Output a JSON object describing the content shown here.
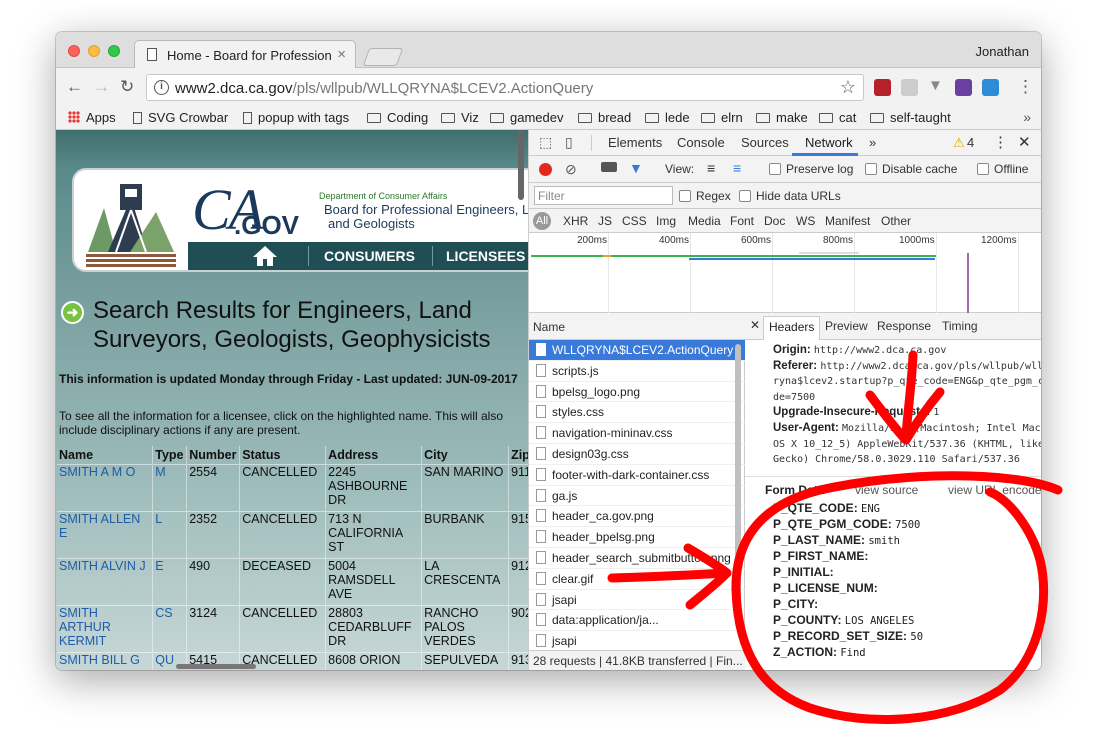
{
  "browser": {
    "tab_title": "Home - Board for Professional",
    "user": "Jonathan",
    "url_host": "www2.dca.ca.gov",
    "url_path": "/pls/wllpub/WLLQRYNA$LCEV2.ActionQuery",
    "bookmarks": [
      "Apps",
      "SVG Crowbar",
      "popup with tags",
      "Coding",
      "Viz",
      "gamedev",
      "bread",
      "lede",
      "elrn",
      "make",
      "cat",
      "self-taught"
    ],
    "bookmarks_more": "»"
  },
  "webpage": {
    "dept": "Department of Consumer Affairs",
    "board_line1": "Board for Professional Engineers, L",
    "board_line2": "and Geologists",
    "logo_ca": "CA",
    "logo_gov": ".GOV",
    "nav": {
      "consumers": "CONSUMERS",
      "licensees": "LICENSEES"
    },
    "heading": "Search Results for Engineers, Land Surveyors, Geologists, Geophysicists",
    "updated": "This information is updated Monday through Friday - Last updated: JUN-09-2017",
    "instructions": "To see all the information for a licensee, click on the highlighted name. This will also include disciplinary actions if any are present.",
    "columns": [
      "Name",
      "Type",
      "Number",
      "Status",
      "Address",
      "City",
      "Zip"
    ],
    "rows": [
      {
        "name": "SMITH A M O",
        "type": "M",
        "number": "2554",
        "status": "CANCELLED",
        "address": "2245 ASHBOURNE DR",
        "city": "SAN MARINO",
        "zip": "911"
      },
      {
        "name": "SMITH ALLEN E",
        "type": "L",
        "number": "2352",
        "status": "CANCELLED",
        "address": "713 N CALIFORNIA ST",
        "city": "BURBANK",
        "zip": "915"
      },
      {
        "name": "SMITH ALVIN J",
        "type": "E",
        "number": "490",
        "status": "DECEASED",
        "address": "5004 RAMSDELL AVE",
        "city": "LA CRESCENTA",
        "zip": "912"
      },
      {
        "name": "SMITH ARTHUR KERMIT",
        "type": "CS",
        "number": "3124",
        "status": "CANCELLED",
        "address": "28803 CEDARBLUFF DR",
        "city": "RANCHO PALOS VERDES",
        "zip": "902"
      },
      {
        "name": "SMITH BILL G",
        "type": "QU",
        "number": "5415",
        "status": "CANCELLED",
        "address": "8608 ORION",
        "city": "SEPULVEDA",
        "zip": "913"
      }
    ]
  },
  "devtools": {
    "tabs": [
      "Elements",
      "Console",
      "Sources",
      "Network",
      "»"
    ],
    "warnings": "4",
    "controls": {
      "view": "View:",
      "preserve_log": "Preserve log",
      "disable_cache": "Disable cache",
      "offline": "Offline"
    },
    "filter_placeholder": "Filter",
    "regex": "Regex",
    "hide_data_urls": "Hide data URLs",
    "types": [
      "All",
      "XHR",
      "JS",
      "CSS",
      "Img",
      "Media",
      "Font",
      "Doc",
      "WS",
      "Manifest",
      "Other"
    ],
    "ticks": [
      "200ms",
      "400ms",
      "600ms",
      "800ms",
      "1000ms",
      "1200ms"
    ],
    "name_header": "Name",
    "requests": [
      "WLLQRYNA$LCEV2.ActionQuery",
      "scripts.js",
      "bpelsg_logo.png",
      "styles.css",
      "navigation-mininav.css",
      "design03g.css",
      "footer-with-dark-container.css",
      "ga.js",
      "header_ca.gov.png",
      "header_bpelsg.png",
      "header_search_submitbutton.png",
      "clear.gif",
      "jsapi",
      "data:application/ja...",
      "jsapi"
    ],
    "summary": "28 requests | 41.8KB transferred | Fin...",
    "detail_tabs": [
      "Headers",
      "Preview",
      "Response",
      "Timing"
    ],
    "headers": [
      {
        "k": "Origin:",
        "v": "http://www2.dca.ca.gov"
      },
      {
        "k": "Referer:",
        "v": "http://www2.dca.ca.gov/pls/wllpub/wllqryna$lcev2.startup?p_qte_code=ENG&p_qte_pgm_code=7500"
      },
      {
        "k": "Upgrade-Insecure-Requests:",
        "v": "1"
      },
      {
        "k": "User-Agent:",
        "v": "Mozilla/5.0 (Macintosh; Intel Mac OS X 10_12_5) AppleWebKit/537.36 (KHTML, like Gecko) Chrome/58.0.3029.110 Safari/537.36"
      }
    ],
    "form_data_title": "Form Data",
    "view_source": "view source",
    "view_url_encoded": "view URL encoded",
    "form_data": [
      {
        "k": "P_QTE_CODE:",
        "v": "ENG"
      },
      {
        "k": "P_QTE_PGM_CODE:",
        "v": "7500"
      },
      {
        "k": "P_LAST_NAME:",
        "v": "smith"
      },
      {
        "k": "P_FIRST_NAME:",
        "v": ""
      },
      {
        "k": "P_INITIAL:",
        "v": ""
      },
      {
        "k": "P_LICENSE_NUM:",
        "v": ""
      },
      {
        "k": "P_CITY:",
        "v": ""
      },
      {
        "k": "P_COUNTY:",
        "v": "LOS ANGELES"
      },
      {
        "k": "P_RECORD_SET_SIZE:",
        "v": "50"
      },
      {
        "k": "Z_ACTION:",
        "v": "Find"
      }
    ]
  },
  "colors": {
    "annotation": "#ff0000",
    "accent": "#3879d9",
    "record": "#e5281b"
  }
}
